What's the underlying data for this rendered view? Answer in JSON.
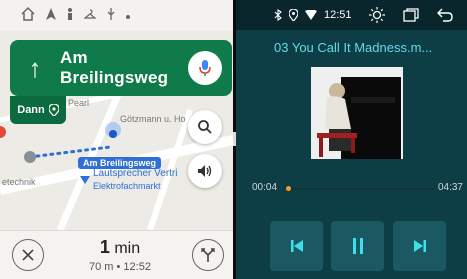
{
  "maps": {
    "status_icons": [
      "home-icon",
      "arrow-icon",
      "person-icon",
      "hanger-icon",
      "usb-icon",
      "dot-icon"
    ],
    "maneuver": {
      "street": "Am Breilingsweg",
      "arrow": "↑"
    },
    "then": {
      "label": "Dann"
    },
    "map_labels": {
      "pearl": "Pearl",
      "gotzmann": "Götzmann u. Ho",
      "street_chip": "Am Breilingsweg",
      "lautsprecher": "Lautsprecher Vertri",
      "elektro": "Elektrofachmarkt",
      "technik": "etechnik"
    },
    "eta": {
      "duration_num": "1",
      "duration_unit": " min",
      "detail": "70 m • 12:52"
    },
    "colors": {
      "nav_green": "#0f7a4a",
      "route_blue": "#2f6fd6"
    }
  },
  "music": {
    "status": {
      "time": "12:51"
    },
    "title": "03 You Call It Madness.m...",
    "current_time": "00:04",
    "end_time": "04:37",
    "progress_fraction": 0.015,
    "colors": {
      "accent_cyan": "#67d8e4",
      "progress_orange": "#ff9a2e",
      "bg_teal": "#0d3e46"
    }
  }
}
